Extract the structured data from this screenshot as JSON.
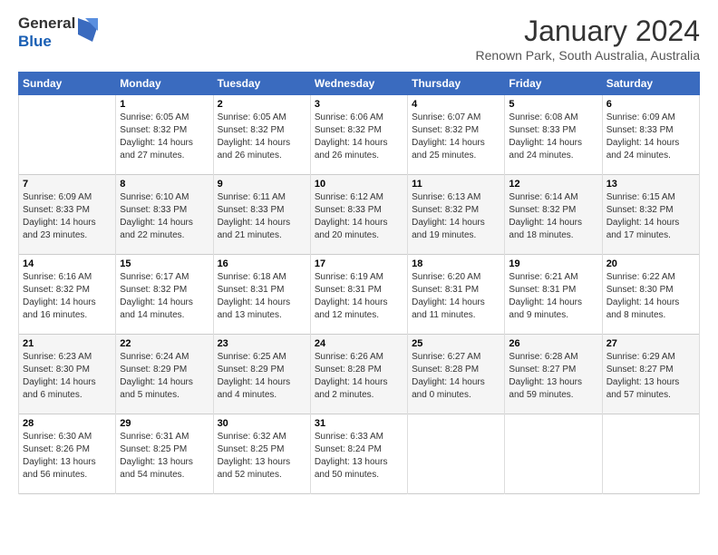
{
  "logo": {
    "general": "General",
    "blue": "Blue"
  },
  "header": {
    "month": "January 2024",
    "location": "Renown Park, South Australia, Australia"
  },
  "days_of_week": [
    "Sunday",
    "Monday",
    "Tuesday",
    "Wednesday",
    "Thursday",
    "Friday",
    "Saturday"
  ],
  "weeks": [
    [
      {
        "day": "",
        "info": ""
      },
      {
        "day": "1",
        "info": "Sunrise: 6:05 AM\nSunset: 8:32 PM\nDaylight: 14 hours and 27 minutes."
      },
      {
        "day": "2",
        "info": "Sunrise: 6:05 AM\nSunset: 8:32 PM\nDaylight: 14 hours and 26 minutes."
      },
      {
        "day": "3",
        "info": "Sunrise: 6:06 AM\nSunset: 8:32 PM\nDaylight: 14 hours and 26 minutes."
      },
      {
        "day": "4",
        "info": "Sunrise: 6:07 AM\nSunset: 8:32 PM\nDaylight: 14 hours and 25 minutes."
      },
      {
        "day": "5",
        "info": "Sunrise: 6:08 AM\nSunset: 8:33 PM\nDaylight: 14 hours and 24 minutes."
      },
      {
        "day": "6",
        "info": "Sunrise: 6:09 AM\nSunset: 8:33 PM\nDaylight: 14 hours and 24 minutes."
      }
    ],
    [
      {
        "day": "7",
        "info": "Sunrise: 6:09 AM\nSunset: 8:33 PM\nDaylight: 14 hours and 23 minutes."
      },
      {
        "day": "8",
        "info": "Sunrise: 6:10 AM\nSunset: 8:33 PM\nDaylight: 14 hours and 22 minutes."
      },
      {
        "day": "9",
        "info": "Sunrise: 6:11 AM\nSunset: 8:33 PM\nDaylight: 14 hours and 21 minutes."
      },
      {
        "day": "10",
        "info": "Sunrise: 6:12 AM\nSunset: 8:33 PM\nDaylight: 14 hours and 20 minutes."
      },
      {
        "day": "11",
        "info": "Sunrise: 6:13 AM\nSunset: 8:32 PM\nDaylight: 14 hours and 19 minutes."
      },
      {
        "day": "12",
        "info": "Sunrise: 6:14 AM\nSunset: 8:32 PM\nDaylight: 14 hours and 18 minutes."
      },
      {
        "day": "13",
        "info": "Sunrise: 6:15 AM\nSunset: 8:32 PM\nDaylight: 14 hours and 17 minutes."
      }
    ],
    [
      {
        "day": "14",
        "info": "Sunrise: 6:16 AM\nSunset: 8:32 PM\nDaylight: 14 hours and 16 minutes."
      },
      {
        "day": "15",
        "info": "Sunrise: 6:17 AM\nSunset: 8:32 PM\nDaylight: 14 hours and 14 minutes."
      },
      {
        "day": "16",
        "info": "Sunrise: 6:18 AM\nSunset: 8:31 PM\nDaylight: 14 hours and 13 minutes."
      },
      {
        "day": "17",
        "info": "Sunrise: 6:19 AM\nSunset: 8:31 PM\nDaylight: 14 hours and 12 minutes."
      },
      {
        "day": "18",
        "info": "Sunrise: 6:20 AM\nSunset: 8:31 PM\nDaylight: 14 hours and 11 minutes."
      },
      {
        "day": "19",
        "info": "Sunrise: 6:21 AM\nSunset: 8:31 PM\nDaylight: 14 hours and 9 minutes."
      },
      {
        "day": "20",
        "info": "Sunrise: 6:22 AM\nSunset: 8:30 PM\nDaylight: 14 hours and 8 minutes."
      }
    ],
    [
      {
        "day": "21",
        "info": "Sunrise: 6:23 AM\nSunset: 8:30 PM\nDaylight: 14 hours and 6 minutes."
      },
      {
        "day": "22",
        "info": "Sunrise: 6:24 AM\nSunset: 8:29 PM\nDaylight: 14 hours and 5 minutes."
      },
      {
        "day": "23",
        "info": "Sunrise: 6:25 AM\nSunset: 8:29 PM\nDaylight: 14 hours and 4 minutes."
      },
      {
        "day": "24",
        "info": "Sunrise: 6:26 AM\nSunset: 8:28 PM\nDaylight: 14 hours and 2 minutes."
      },
      {
        "day": "25",
        "info": "Sunrise: 6:27 AM\nSunset: 8:28 PM\nDaylight: 14 hours and 0 minutes."
      },
      {
        "day": "26",
        "info": "Sunrise: 6:28 AM\nSunset: 8:27 PM\nDaylight: 13 hours and 59 minutes."
      },
      {
        "day": "27",
        "info": "Sunrise: 6:29 AM\nSunset: 8:27 PM\nDaylight: 13 hours and 57 minutes."
      }
    ],
    [
      {
        "day": "28",
        "info": "Sunrise: 6:30 AM\nSunset: 8:26 PM\nDaylight: 13 hours and 56 minutes."
      },
      {
        "day": "29",
        "info": "Sunrise: 6:31 AM\nSunset: 8:25 PM\nDaylight: 13 hours and 54 minutes."
      },
      {
        "day": "30",
        "info": "Sunrise: 6:32 AM\nSunset: 8:25 PM\nDaylight: 13 hours and 52 minutes."
      },
      {
        "day": "31",
        "info": "Sunrise: 6:33 AM\nSunset: 8:24 PM\nDaylight: 13 hours and 50 minutes."
      },
      {
        "day": "",
        "info": ""
      },
      {
        "day": "",
        "info": ""
      },
      {
        "day": "",
        "info": ""
      }
    ]
  ]
}
